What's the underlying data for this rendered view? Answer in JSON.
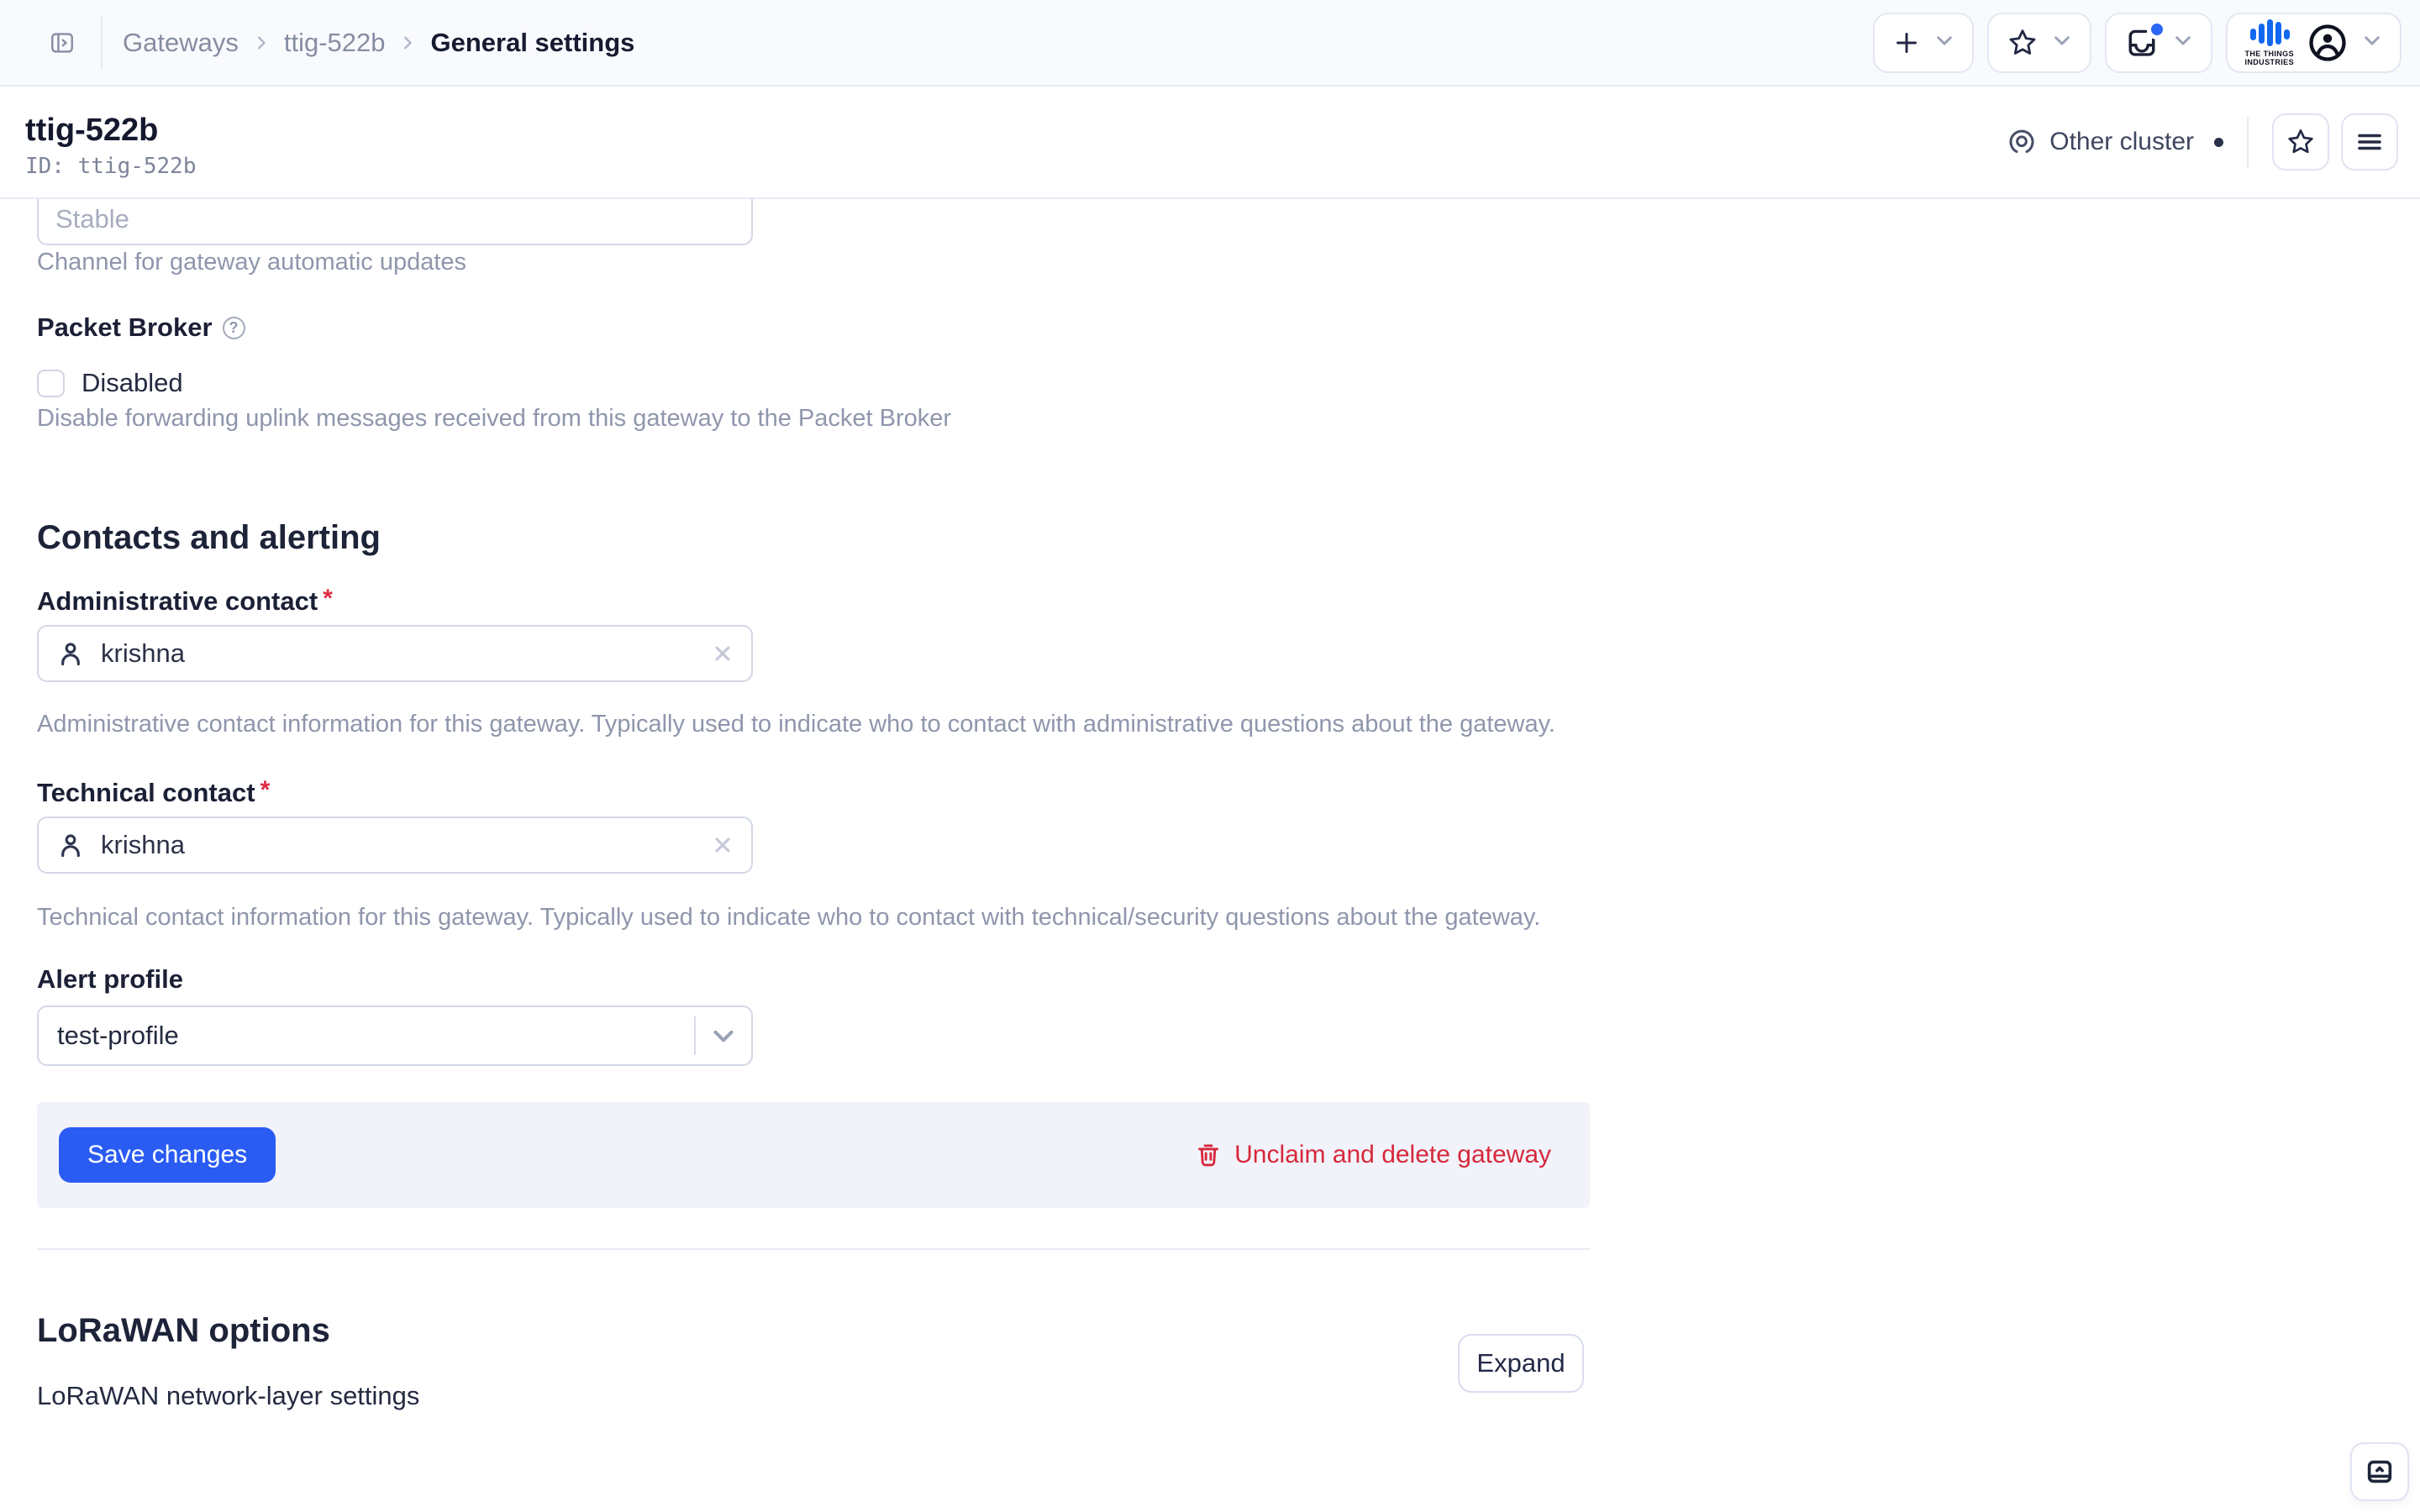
{
  "colors": {
    "accent_blue": "#2a5cf4",
    "danger_red": "#d6283c",
    "notification_dot_blue": "#2d68f5",
    "logo_blue": "#1268f0",
    "border_gray": "#d3d8e6",
    "muted_text": "#8f96ac"
  },
  "topbar": {
    "breadcrumb": {
      "items": [
        {
          "label": "Gateways"
        },
        {
          "label": "ttig-522b"
        },
        {
          "label": "General settings"
        }
      ]
    },
    "logo_text": "THE THINGS\nINDUSTRIES"
  },
  "header": {
    "title": "ttig-522b",
    "entity_id": "ID: ttig-522b",
    "cluster_label": "Other cluster"
  },
  "form": {
    "update_channel": {
      "placeholder": "Stable",
      "help": "Channel for gateway automatic updates"
    },
    "packet_broker": {
      "label": "Packet Broker",
      "help_icon": "?",
      "checkbox_label": "Disabled",
      "help": "Disable forwarding uplink messages received from this gateway to the Packet Broker"
    },
    "contacts_section": {
      "heading": "Contacts and alerting",
      "admin_contact": {
        "label": "Administrative contact",
        "required_mark": "*",
        "value": "krishna",
        "help": "Administrative contact information for this gateway. Typically used to indicate who to contact with administrative questions about the gateway."
      },
      "tech_contact": {
        "label": "Technical contact",
        "required_mark": "*",
        "value": "krishna",
        "help": "Technical contact information for this gateway. Typically used to indicate who to contact with technical/security questions about the gateway."
      },
      "alert_profile": {
        "label": "Alert profile",
        "value": "test-profile"
      }
    },
    "submit_bar": {
      "save_label": "Save changes",
      "delete_label": "Unclaim and delete gateway"
    }
  },
  "lorawan_section": {
    "heading": "LoRaWAN options",
    "subtitle": "LoRaWAN network-layer settings",
    "expand_label": "Expand"
  }
}
